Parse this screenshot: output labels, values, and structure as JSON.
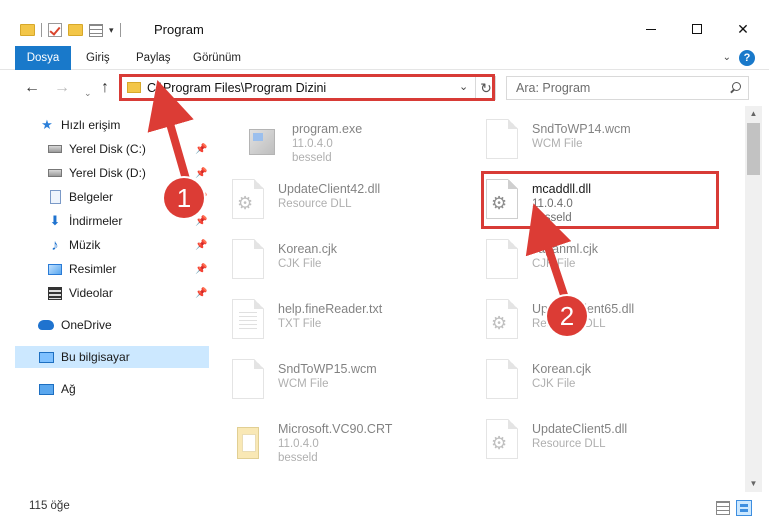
{
  "window": {
    "title": "Program",
    "minimize_icon": "minimize-icon",
    "maximize_icon": "maximize-icon",
    "close_glyph": "✕"
  },
  "ribbon": {
    "tabs": [
      {
        "label": "Dosya",
        "active": true
      },
      {
        "label": "Giriş"
      },
      {
        "label": "Paylaş"
      },
      {
        "label": "Görünüm"
      }
    ],
    "help_glyph": "?",
    "expand_glyph": "⌄"
  },
  "nav": {
    "back_glyph": "←",
    "forward_glyph": "→",
    "recent_glyph": "⌄",
    "up_glyph": "↑",
    "address": "C:\\Program Files\\Program Dizini",
    "address_dropdown_glyph": "⌄",
    "refresh_glyph": "↻",
    "search_placeholder": "Ara: Program"
  },
  "sidebar": {
    "items": [
      {
        "label": "Hızlı erişim",
        "icon": "star-icon",
        "glyph": "★"
      },
      {
        "label": "Yerel Disk (C:)",
        "icon": "disk-icon",
        "pin": "📌"
      },
      {
        "label": "Yerel Disk (D:)",
        "icon": "disk-icon",
        "pin": "📌"
      },
      {
        "label": "Belgeler",
        "icon": "documents-icon",
        "pin": "📌"
      },
      {
        "label": "İndirmeler",
        "icon": "download-icon",
        "glyph": "⬇",
        "pin": "📌"
      },
      {
        "label": "Müzik",
        "icon": "music-icon",
        "glyph": "♪",
        "pin": "📌"
      },
      {
        "label": "Resimler",
        "icon": "pictures-icon",
        "pin": "📌"
      },
      {
        "label": "Videolar",
        "icon": "videos-icon",
        "pin": "📌"
      },
      {
        "label": "OneDrive",
        "icon": "cloud-icon"
      },
      {
        "label": "Bu bilgisayar",
        "icon": "computer-icon",
        "selected": true
      },
      {
        "label": "Ağ",
        "icon": "network-icon"
      }
    ]
  },
  "files": [
    {
      "name": "program.exe",
      "line1": "11.0.4.0",
      "line2": "besseld",
      "icon": "exe-file-icon"
    },
    {
      "name": "SndToWP14.wcm",
      "line1": "WCM File",
      "line2": "",
      "icon": "blank-file-icon"
    },
    {
      "name": "UpdateClient42.dll",
      "line1": "Resource DLL",
      "line2": "",
      "icon": "dll-file-icon"
    },
    {
      "name": "mcaddll.dll",
      "line1": "11.0.4.0",
      "line2": "besseld",
      "icon": "dll-file-icon"
    },
    {
      "name": "Korean.cjk",
      "line1": "CJK File",
      "line2": "",
      "icon": "blank-file-icon"
    },
    {
      "name": "Japanml.cjk",
      "line1": "CJK File",
      "line2": "",
      "icon": "blank-file-icon"
    },
    {
      "name": "help.fineReader.txt",
      "line1": "TXT File",
      "line2": "",
      "icon": "text-file-icon"
    },
    {
      "name": "UpdateClient65.dll",
      "line1": "Resource DLL",
      "line2": "",
      "icon": "dll-file-icon"
    },
    {
      "name": "SndToWP15.wcm",
      "line1": "WCM File",
      "line2": "",
      "icon": "blank-file-icon"
    },
    {
      "name": "Korean.cjk",
      "line1": "CJK File",
      "line2": "",
      "icon": "blank-file-icon"
    },
    {
      "name": "Microsoft.VC90.CRT",
      "line1": "11.0.4.0",
      "line2": "besseld",
      "icon": "crt-folder-icon"
    },
    {
      "name": "UpdateClient5.dll",
      "line1": "Resource DLL",
      "line2": "",
      "icon": "dll-file-icon"
    }
  ],
  "status": {
    "count": "115 öğe"
  },
  "callouts": {
    "first": "1",
    "second": "2"
  },
  "colors": {
    "accent": "#1979ca",
    "callout": "#dc3c35",
    "selection": "#cce8ff"
  }
}
